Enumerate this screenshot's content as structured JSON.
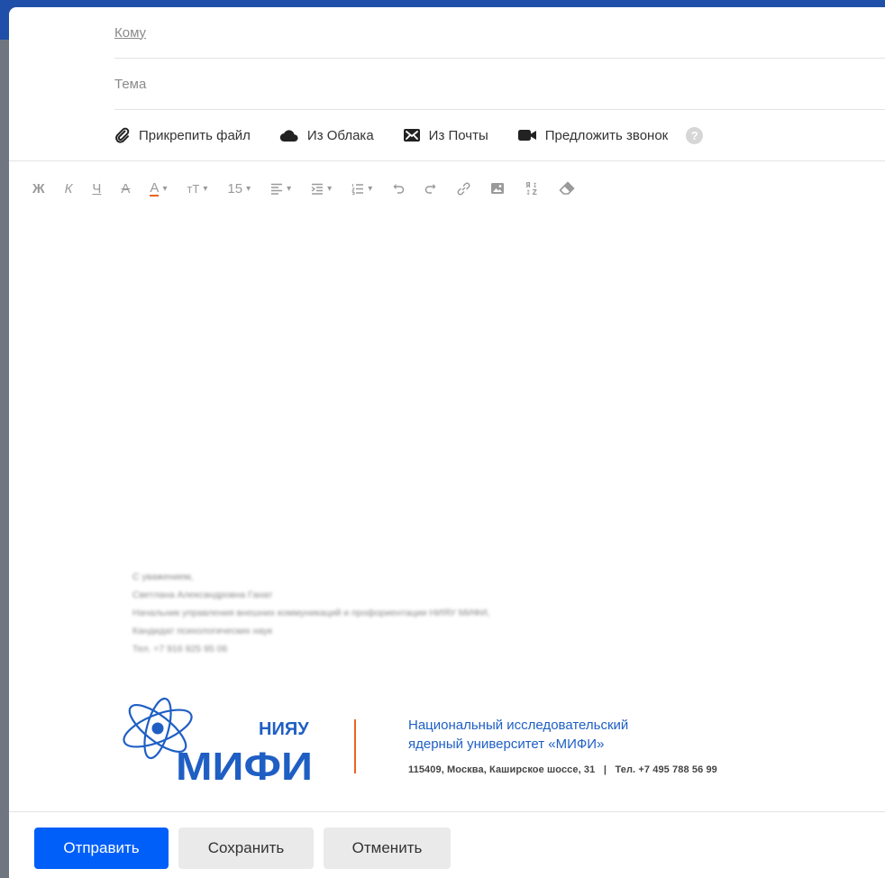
{
  "compose": {
    "to_label": "Кому",
    "subject_placeholder": "Тема"
  },
  "attachments": {
    "attach_file": "Прикрепить файл",
    "from_cloud": "Из Облака",
    "from_mail": "Из Почты",
    "propose_call": "Предложить звонок",
    "help": "?"
  },
  "toolbar": {
    "bold": "Ж",
    "italic": "К",
    "underline": "Ч",
    "strikethrough": "А",
    "text_color": "А",
    "text_size_style": "тТ",
    "font_size": "15"
  },
  "signature": {
    "lines": [
      "С уважением,",
      "Светлана Александровна Ганат",
      "Начальник управления внешних коммуникаций и профориентации НИЯУ МИФИ,",
      "Кандидат психологических наук",
      "Тел. +7 916 925 95 06"
    ]
  },
  "logo": {
    "abbr": "НИЯУ",
    "name": "МИФИ"
  },
  "university": {
    "name_line1": "Национальный исследовательский",
    "name_line2": "ядерный университет «МИФИ»",
    "address": "115409, Москва, Каширское шоссе, 31   |   Тел. +7 495 788 56 99"
  },
  "buttons": {
    "send": "Отправить",
    "save": "Сохранить",
    "cancel": "Отменить"
  },
  "colors": {
    "primary": "#005ff9",
    "logo_blue": "#1f5fc4",
    "accent_orange": "#e8651f"
  }
}
